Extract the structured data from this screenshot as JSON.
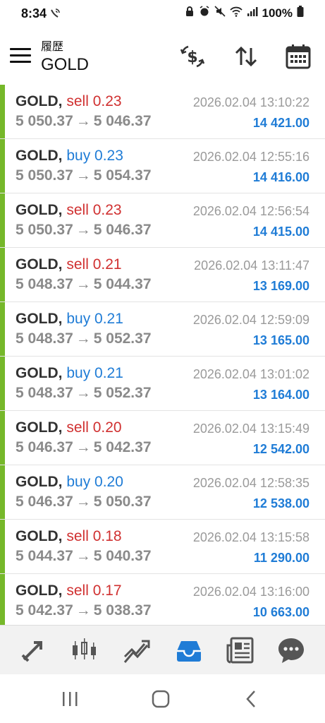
{
  "status_bar": {
    "time": "8:34",
    "battery": "100%"
  },
  "header": {
    "subtitle": "履歴",
    "title": "GOLD"
  },
  "colors": {
    "accent_green": "#76b82a",
    "sell_red": "#d03030",
    "buy_blue": "#1f7cd6",
    "price_gray": "#8a8a8a",
    "nav_active": "#1f7cd6"
  },
  "deals": [
    {
      "symbol": "GOLD,",
      "type": "sell",
      "volume": "0.23",
      "open_price": "5 050.37",
      "close_price": "5 046.37",
      "arrow": "→",
      "time": "2026.02.04 13:10:22",
      "profit": "14 421.00"
    },
    {
      "symbol": "GOLD,",
      "type": "buy",
      "volume": "0.23",
      "open_price": "5 050.37",
      "close_price": "5 054.37",
      "arrow": "→",
      "time": "2026.02.04 12:55:16",
      "profit": "14 416.00"
    },
    {
      "symbol": "GOLD,",
      "type": "sell",
      "volume": "0.23",
      "open_price": "5 050.37",
      "close_price": "5 046.37",
      "arrow": "→",
      "time": "2026.02.04 12:56:54",
      "profit": "14 415.00"
    },
    {
      "symbol": "GOLD,",
      "type": "sell",
      "volume": "0.21",
      "open_price": "5 048.37",
      "close_price": "5 044.37",
      "arrow": "→",
      "time": "2026.02.04 13:11:47",
      "profit": "13 169.00"
    },
    {
      "symbol": "GOLD,",
      "type": "buy",
      "volume": "0.21",
      "open_price": "5 048.37",
      "close_price": "5 052.37",
      "arrow": "→",
      "time": "2026.02.04 12:59:09",
      "profit": "13 165.00"
    },
    {
      "symbol": "GOLD,",
      "type": "buy",
      "volume": "0.21",
      "open_price": "5 048.37",
      "close_price": "5 052.37",
      "arrow": "→",
      "time": "2026.02.04 13:01:02",
      "profit": "13 164.00"
    },
    {
      "symbol": "GOLD,",
      "type": "sell",
      "volume": "0.20",
      "open_price": "5 046.37",
      "close_price": "5 042.37",
      "arrow": "→",
      "time": "2026.02.04 13:15:49",
      "profit": "12 542.00"
    },
    {
      "symbol": "GOLD,",
      "type": "buy",
      "volume": "0.20",
      "open_price": "5 046.37",
      "close_price": "5 050.37",
      "arrow": "→",
      "time": "2026.02.04 12:58:35",
      "profit": "12 538.00"
    },
    {
      "symbol": "GOLD,",
      "type": "sell",
      "volume": "0.18",
      "open_price": "5 044.37",
      "close_price": "5 040.37",
      "arrow": "→",
      "time": "2026.02.04 13:15:58",
      "profit": "11 290.00"
    },
    {
      "symbol": "GOLD,",
      "type": "sell",
      "volume": "0.17",
      "open_price": "5 042.37",
      "close_price": "5 038.37",
      "arrow": "→",
      "time": "2026.02.04 13:16:00",
      "profit": "10 663.00"
    }
  ],
  "bottom_nav": [
    {
      "icon": "quotes-icon",
      "active": false
    },
    {
      "icon": "chart-icon",
      "active": false
    },
    {
      "icon": "trade-icon",
      "active": false
    },
    {
      "icon": "history-inbox-icon",
      "active": true
    },
    {
      "icon": "news-icon",
      "active": false
    },
    {
      "icon": "chat-icon",
      "active": false
    }
  ]
}
